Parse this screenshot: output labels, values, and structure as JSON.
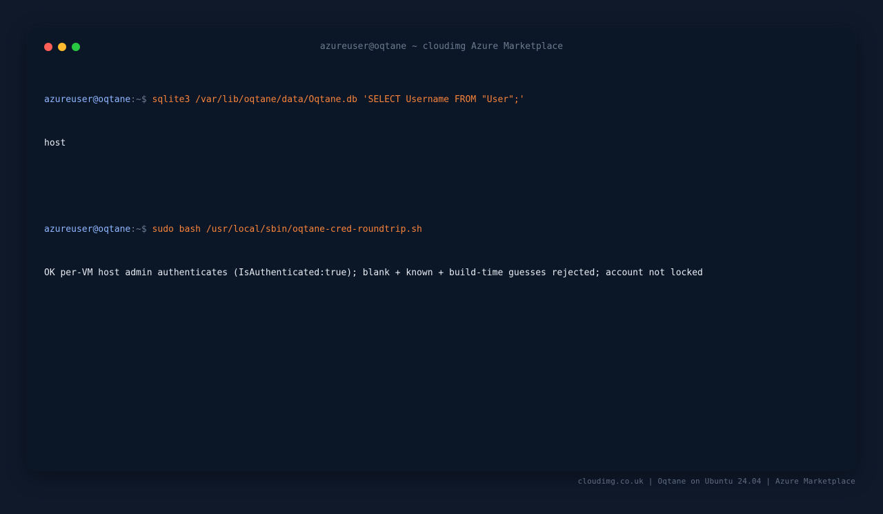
{
  "window": {
    "title": "azureuser@oqtane ~ cloudimg Azure Marketplace"
  },
  "colors": {
    "background": "#0f192a",
    "terminal_bg": "#0b1627",
    "prompt": "#8fb6ff",
    "command": "#f7843a",
    "output": "#e6ebf2",
    "muted": "#6b7a90",
    "close": "#ff5f57",
    "minimize": "#febc2e",
    "maximize": "#28c840"
  },
  "terminal": {
    "entries": [
      {
        "prompt_user": "azureuser@oqtane",
        "prompt_path": ":~$ ",
        "command": "sqlite3 /var/lib/oqtane/data/Oqtane.db 'SELECT Username FROM \"User\";'",
        "output": "host"
      },
      {
        "prompt_user": "azureuser@oqtane",
        "prompt_path": ":~$ ",
        "command": "sudo bash /usr/local/sbin/oqtane-cred-roundtrip.sh",
        "output": "OK per-VM host admin authenticates (IsAuthenticated:true); blank + known + build-time guesses rejected; account not locked"
      }
    ]
  },
  "footer": {
    "text": "cloudimg.co.uk | Oqtane on Ubuntu 24.04 | Azure Marketplace"
  }
}
